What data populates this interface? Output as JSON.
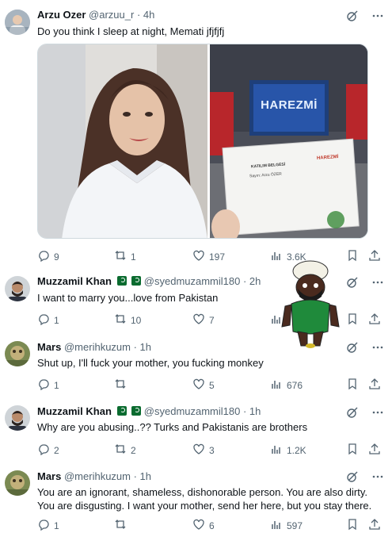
{
  "tweets": [
    {
      "name": "Arzu Ozer",
      "handle": "@arzuu_r",
      "time": "· 4h",
      "text": "Do you think I sleep at night, Memati jfjfjfj",
      "stats": {
        "replies": "9",
        "reposts": "1",
        "likes": "197",
        "views": "3.6K"
      }
    },
    {
      "name": "Muzzamil Khan",
      "handle": "@syedmuzammil180",
      "time": "· 2h",
      "text": "I want to marry you...love from Pakistan",
      "stats": {
        "replies": "1",
        "reposts": "10",
        "likes": "7",
        "views": ""
      }
    },
    {
      "name": "Mars",
      "handle": "@merihkuzum",
      "time": "· 1h",
      "text": "Shut up, I'll fuck your mother, you fucking monkey",
      "stats": {
        "replies": "1",
        "reposts": "",
        "likes": "5",
        "views": "676"
      }
    },
    {
      "name": "Muzzamil Khan",
      "handle": "@syedmuzammil180",
      "time": "· 1h",
      "text": "Why are you abusing..?? Turks and Pakistanis are brothers",
      "stats": {
        "replies": "2",
        "reposts": "2",
        "likes": "3",
        "views": "1.2K"
      }
    },
    {
      "name": "Mars",
      "handle": "@merihkuzum",
      "time": "· 1h",
      "text": "You are an ignorant, shameless, dishonorable person. You are also dirty. You are disgusting. I want your mother, send her here, but you stay there.",
      "stats": {
        "replies": "1",
        "reposts": "",
        "likes": "6",
        "views": "597"
      }
    }
  ],
  "media": {
    "screen_title": "HAREZMİ",
    "certificate_title": "KATILIM BELGESİ",
    "certificate_name": "Sayın: Arzu ÖZER",
    "certificate_brand": "HAREZMİ"
  },
  "colors": {
    "text": "#0f1419",
    "muted": "#536471",
    "border": "#cfd9de",
    "pk_green": "#0a6b2f"
  }
}
